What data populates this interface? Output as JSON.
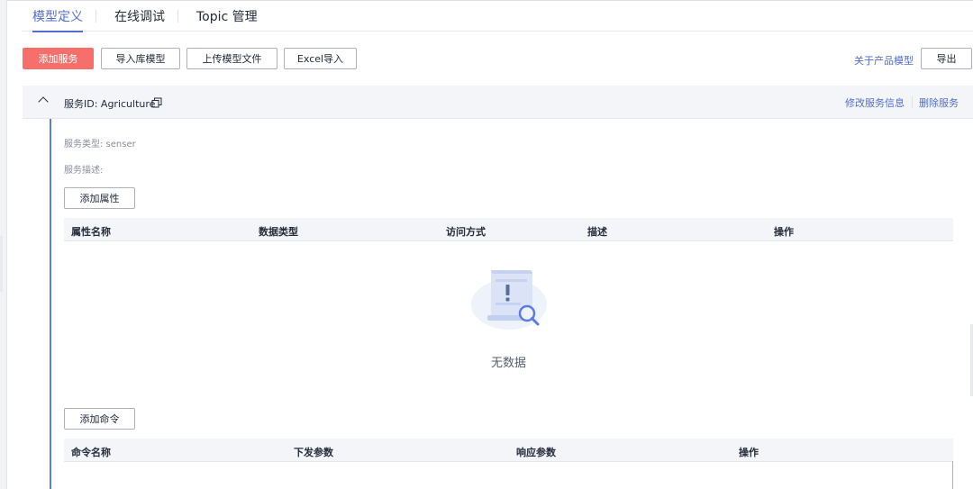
{
  "tabs": [
    {
      "label": "模型定义",
      "active": true
    },
    {
      "label": "在线调试",
      "active": false
    },
    {
      "label": "Topic 管理",
      "active": false
    }
  ],
  "toolbar": {
    "add_service": "添加服务",
    "import_library_model": "导入库模型",
    "upload_model_file": "上传模型文件",
    "excel_import": "Excel导入",
    "about_product_model": "关于产品模型",
    "export": "导出"
  },
  "service": {
    "id_label": "服务ID: Agriculture",
    "edit_info": "修改服务信息",
    "delete": "删除服务",
    "type_label": "服务类型: senser",
    "desc_label": "服务描述:"
  },
  "properties": {
    "add_button": "添加属性",
    "columns": [
      "属性名称",
      "数据类型",
      "访问方式",
      "描述",
      "操作"
    ],
    "empty_text": "无数据"
  },
  "commands": {
    "add_button": "添加命令",
    "columns": [
      "命令名称",
      "下发参数",
      "响应参数",
      "操作"
    ]
  },
  "colors": {
    "accent": "#526ecc",
    "primary_button": "#f66f6a",
    "header_bg": "#f3f5f9"
  }
}
